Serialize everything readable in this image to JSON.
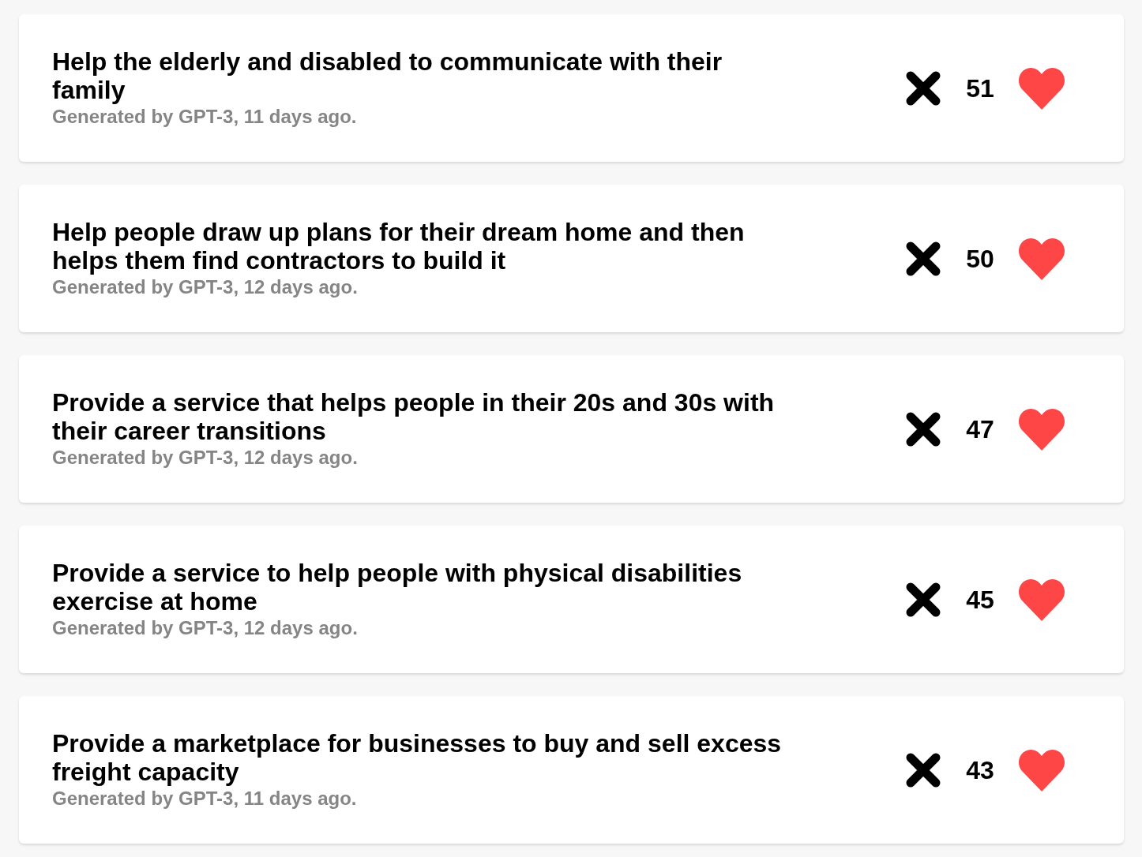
{
  "ideas": [
    {
      "title": "Help the elderly and disabled to communicate with their family",
      "meta": "Generated by GPT-3, 11 days ago.",
      "votes": "51"
    },
    {
      "title": "Help people draw up plans for their dream home and then helps them find contractors to build it",
      "meta": "Generated by GPT-3, 12 days ago.",
      "votes": "50"
    },
    {
      "title": "Provide a service that helps people in their 20s and 30s with their career transitions",
      "meta": "Generated by GPT-3, 12 days ago.",
      "votes": "47"
    },
    {
      "title": "Provide a service to help people with physical disabilities exercise at home",
      "meta": "Generated by GPT-3, 12 days ago.",
      "votes": "45"
    },
    {
      "title": "Provide a marketplace for businesses to buy and sell excess freight capacity",
      "meta": "Generated by GPT-3, 11 days ago.",
      "votes": "43"
    }
  ]
}
